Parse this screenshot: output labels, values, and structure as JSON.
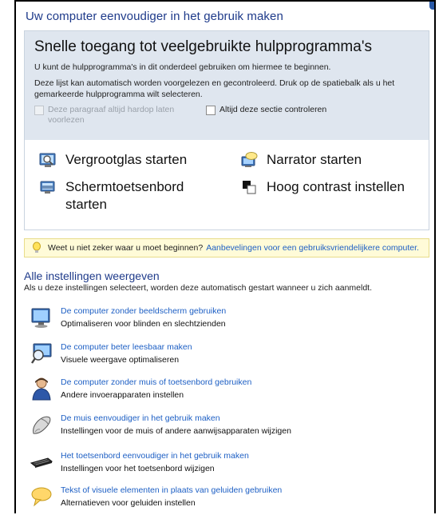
{
  "page": {
    "title": "Uw computer eenvoudiger in het gebruik maken"
  },
  "quick_access": {
    "heading": "Snelle toegang tot veelgebruikte hulpprogramma's",
    "desc1": "U kunt de hulpprogramma's in dit onderdeel gebruiken om hiermee te beginnen.",
    "desc2": "Deze lijst kan automatisch worden voorgelezen en gecontroleerd. Druk op de spatiebalk als u het gemarkeerde hulpprogramma wilt selecteren.",
    "check_read_aloud": "Deze paragraaf altijd hardop laten voorlezen",
    "check_scan": "Altijd deze sectie controleren",
    "tools": {
      "magnifier": "Vergrootglas starten",
      "narrator": "Narrator starten",
      "osk": "Schermtoetsenbord starten",
      "contrast": "Hoog contrast instellen"
    }
  },
  "tip": {
    "text": "Weet u niet zeker waar u moet beginnen?",
    "link": "Aanbevelingen voor een gebruiksvriendelijkere computer."
  },
  "all_settings": {
    "title": "Alle instellingen weergeven",
    "subtitle": "Als u deze instellingen selecteert, worden deze automatisch gestart wanneer u zich aanmeldt.",
    "items": [
      {
        "title": "De computer zonder beeldscherm gebruiken",
        "desc": "Optimaliseren voor blinden en slechtzienden",
        "icon": "monitor-icon"
      },
      {
        "title": "De computer beter leesbaar maken",
        "desc": "Visuele weergave optimaliseren",
        "icon": "magnifier-monitor-icon"
      },
      {
        "title": "De computer zonder muis of toetsenbord gebruiken",
        "desc": "Andere invoerapparaten instellen",
        "icon": "user-icon"
      },
      {
        "title": "De muis eenvoudiger in het gebruik maken",
        "desc": "Instellingen voor de muis of andere aanwijsapparaten wijzigen",
        "icon": "mouse-icon"
      },
      {
        "title": "Het toetsenbord eenvoudiger in het gebruik maken",
        "desc": "Instellingen voor het toetsenbord wijzigen",
        "icon": "keyboard-icon"
      },
      {
        "title": "Tekst of visuele elementen in plaats van geluiden gebruiken",
        "desc": "Alternatieven voor geluiden instellen",
        "icon": "speech-bubble-icon"
      }
    ]
  }
}
